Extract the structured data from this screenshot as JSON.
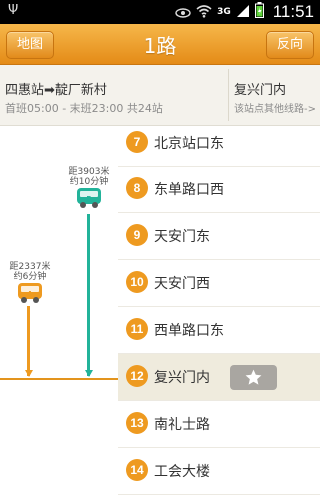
{
  "status_bar": {
    "time": "11:51",
    "network": "3G"
  },
  "header": {
    "title": "1路",
    "left_button": "地图",
    "right_button": "反向"
  },
  "info": {
    "route": "四惠站➡靛厂新村",
    "meta": "首班05:00 - 末班23:00 共24站",
    "nearest_stop": "复兴门内",
    "other_lines": "该站点其他线路->"
  },
  "buses": [
    {
      "letter": "B",
      "distance": "距3903米",
      "eta": "约10分钟",
      "color": "#22b39a"
    },
    {
      "letter": "A",
      "distance": "距2337米",
      "eta": "约6分钟",
      "color": "#ee9a20"
    }
  ],
  "stations": [
    {
      "num": "7",
      "name": "北京站口东"
    },
    {
      "num": "8",
      "name": "东单路口西"
    },
    {
      "num": "9",
      "name": "天安门东"
    },
    {
      "num": "10",
      "name": "天安门西"
    },
    {
      "num": "11",
      "name": "西单路口东"
    },
    {
      "num": "12",
      "name": "复兴门内",
      "current": true
    },
    {
      "num": "13",
      "name": "南礼士路"
    },
    {
      "num": "14",
      "name": "工会大楼"
    }
  ],
  "colors": {
    "accent": "#ee9a20",
    "teal": "#22b39a",
    "favorite": "#a9a6a1"
  }
}
